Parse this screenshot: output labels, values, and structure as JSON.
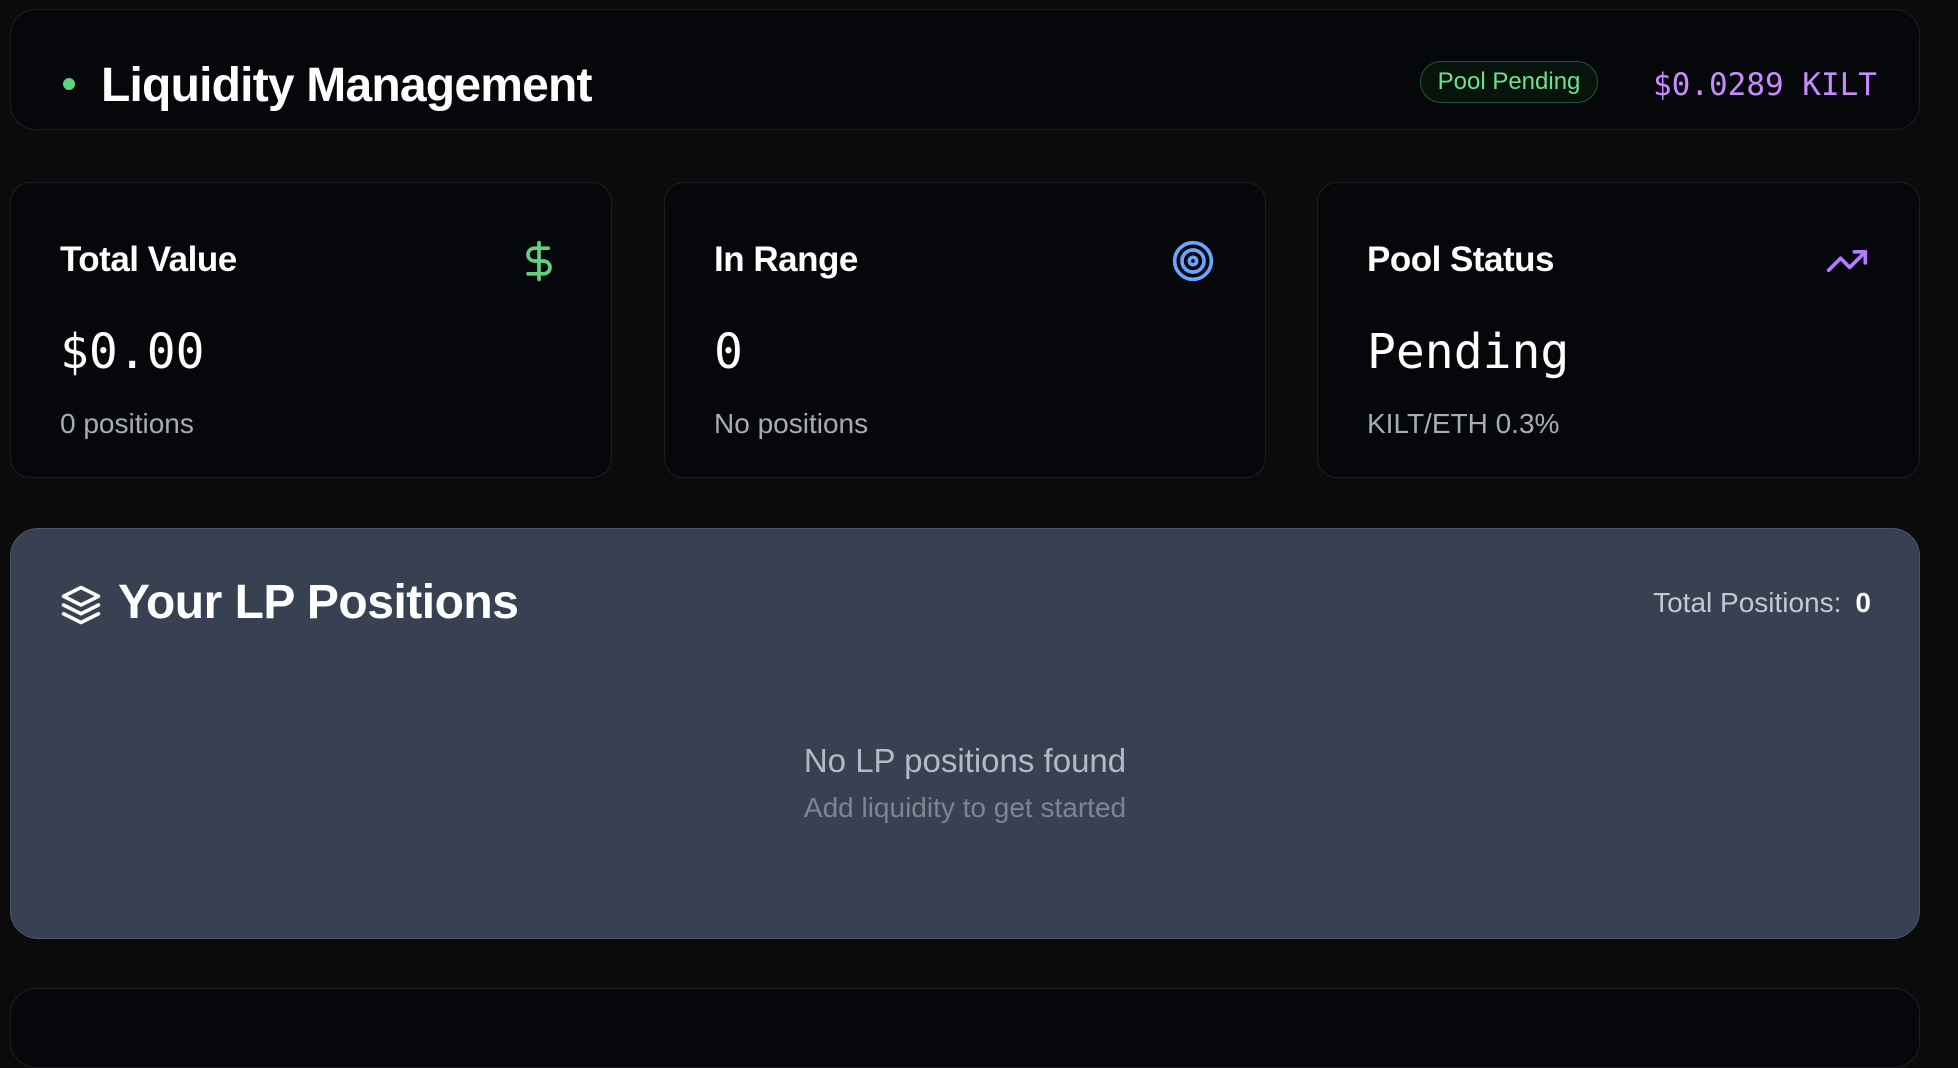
{
  "header": {
    "title": "Liquidity Management",
    "badge": "Pool Pending",
    "price": "$0.0289 KILT",
    "status_dot_color": "#5fd27d"
  },
  "cards": [
    {
      "title": "Total Value",
      "icon": "dollar-icon",
      "value": "$0.00",
      "sub": "0 positions",
      "icon_color": "#5fd27d"
    },
    {
      "title": "In Range",
      "icon": "target-icon",
      "value": "0",
      "sub": "No positions",
      "icon_color": "#6aa4ff"
    },
    {
      "title": "Pool Status",
      "icon": "trending-up-icon",
      "value": "Pending",
      "sub": "KILT/ETH 0.3%",
      "icon_color": "#b47cff"
    }
  ],
  "lp_positions": {
    "title": "Your LP Positions",
    "icon": "layers-icon",
    "total_label": "Total Positions:",
    "total_value": "0",
    "empty_title": "No LP positions found",
    "empty_subtitle": "Add liquidity to get started"
  }
}
